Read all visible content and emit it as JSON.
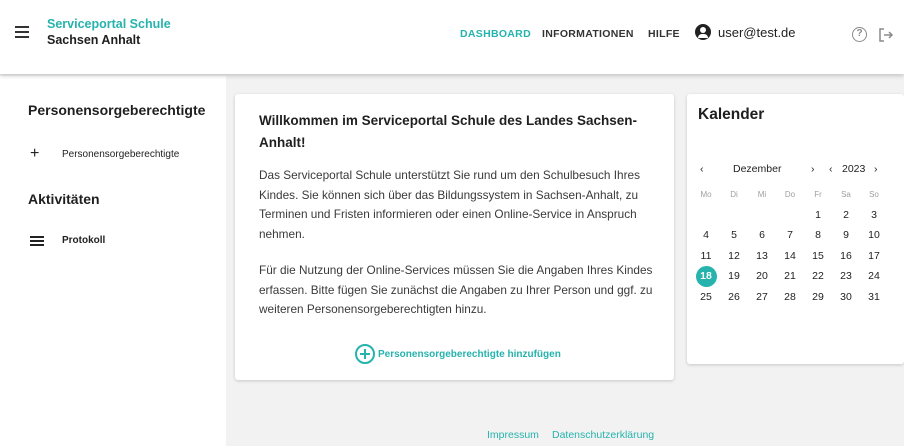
{
  "header": {
    "brand_line1": "Serviceportal Schule",
    "brand_line2": "Sachsen Anhalt",
    "nav": [
      "DASHBOARD",
      "INFORMATIONEN",
      "HILFE"
    ],
    "user": "user@test.de",
    "help_glyph": "?"
  },
  "sidebar": {
    "heading1": "Personensorgeberechtigte",
    "item1": "Personensorgeberechtigte",
    "item1_glyph": "+",
    "heading2": "Aktivitäten",
    "item2": "Protokoll"
  },
  "welcome": {
    "title": "Willkommen im Serviceportal Schule des Landes Sachsen-Anhalt!",
    "p1": "Das Serviceportal Schule unterstützt Sie rund um den Schulbesuch Ihres Kindes. Sie können sich über das Bildungssystem in Sachsen-Anhalt, zu Terminen und Fristen informieren oder einen Online-Service in Anspruch nehmen.",
    "p2": "Für die Nutzung der Online-Services müssen Sie die Angaben Ihres Kindes erfassen. Bitte fügen Sie zunächst die Angaben zu Ihrer Person und ggf. zu weiteren Personensorgeberechtigten hinzu.",
    "add_label": "Personensorgeberechtigte hinzufügen"
  },
  "calendar": {
    "title": "Kalender",
    "month": "Dezember",
    "year": "2023",
    "prev": "‹",
    "next": "›",
    "weekdays": [
      "Mo",
      "Di",
      "Mi",
      "Do",
      "Fr",
      "Sa",
      "So"
    ],
    "weeks": [
      [
        "",
        "",
        "",
        "",
        "1",
        "2",
        "3"
      ],
      [
        "4",
        "5",
        "6",
        "7",
        "8",
        "9",
        "10"
      ],
      [
        "11",
        "12",
        "13",
        "14",
        "15",
        "16",
        "17"
      ],
      [
        "18",
        "19",
        "20",
        "21",
        "22",
        "23",
        "24"
      ],
      [
        "25",
        "26",
        "27",
        "28",
        "29",
        "30",
        "31"
      ]
    ],
    "today": "18"
  },
  "footer": {
    "impressum": "Impressum",
    "datenschutz": "Datenschutzerklärung"
  },
  "colors": {
    "accent": "#26b3ad",
    "background": "#f2f2f2"
  }
}
